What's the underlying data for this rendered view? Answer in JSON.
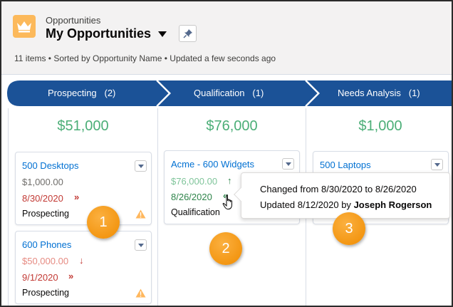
{
  "header": {
    "object_name": "Opportunities",
    "list_title": "My Opportunities",
    "summary": "11 items • Sorted by Opportunity Name • Updated a few seconds ago",
    "app_icon": "crown-icon",
    "pin_icon": "pin-icon"
  },
  "path": {
    "stages": [
      {
        "name": "Prospecting",
        "count": "(2)"
      },
      {
        "name": "Qualification",
        "count": "(1)"
      },
      {
        "name": "Needs Analysis",
        "count": "(1)"
      }
    ],
    "color": "#1b5297"
  },
  "columns": [
    {
      "total": "$51,000",
      "cards": [
        {
          "name": "500 Desktops",
          "amount": "$1,000.00",
          "date": "8/30/2020",
          "date_mark": "»",
          "stage": "Prospecting",
          "warning": true
        },
        {
          "name": "600 Phones",
          "amount": "$50,000.00",
          "amount_mark": "↓",
          "date": "9/1/2020",
          "date_mark": "»",
          "stage": "Prospecting",
          "warning": true
        }
      ]
    },
    {
      "total": "$76,000",
      "cards": [
        {
          "name": "Acme - 600 Widgets",
          "amount": "$76,000.00",
          "amount_mark": "↑",
          "date": "8/26/2020",
          "date_mark": "«",
          "stage": "Qualification"
        }
      ]
    },
    {
      "total": "$1,000",
      "cards": [
        {
          "name": "500 Laptops"
        }
      ]
    }
  ],
  "tooltip": {
    "line1": "Changed from 8/30/2020 to 8/26/2020",
    "line2_prefix": "Updated 8/12/2020 by",
    "line2_user": "Joseph Rogerson"
  },
  "callouts": [
    "1",
    "2",
    "3"
  ],
  "colors": {
    "green": "#4bae77",
    "red": "#c23934",
    "link": "#0070d2",
    "callout": "#f59a1a",
    "warning": "#ffb75d"
  }
}
